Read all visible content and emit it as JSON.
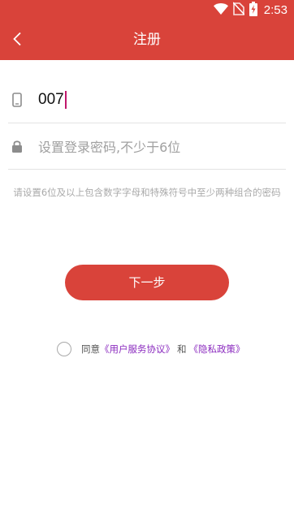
{
  "status_bar": {
    "time": "2:53",
    "icons": [
      "wifi-icon",
      "no-sim-icon",
      "battery-charging-icon"
    ]
  },
  "header": {
    "title": "注册",
    "back_icon": "chevron-left-icon"
  },
  "form": {
    "phone": {
      "icon": "phone-icon",
      "value": "007"
    },
    "password": {
      "icon": "lock-icon",
      "placeholder": "设置登录密码,不少于6位"
    },
    "hint": "请设置6位及以上包含数字字母和特殊符号中至少两种组合的密码"
  },
  "next_button": {
    "label": "下一步"
  },
  "agreement": {
    "prefix": "同意",
    "user_agreement": "《用户服务协议》",
    "and": "和",
    "privacy_policy": "《隐私政策》"
  },
  "colors": {
    "primary": "#d9433a",
    "link": "#8b2bbf",
    "hint": "#aaaaaa"
  }
}
